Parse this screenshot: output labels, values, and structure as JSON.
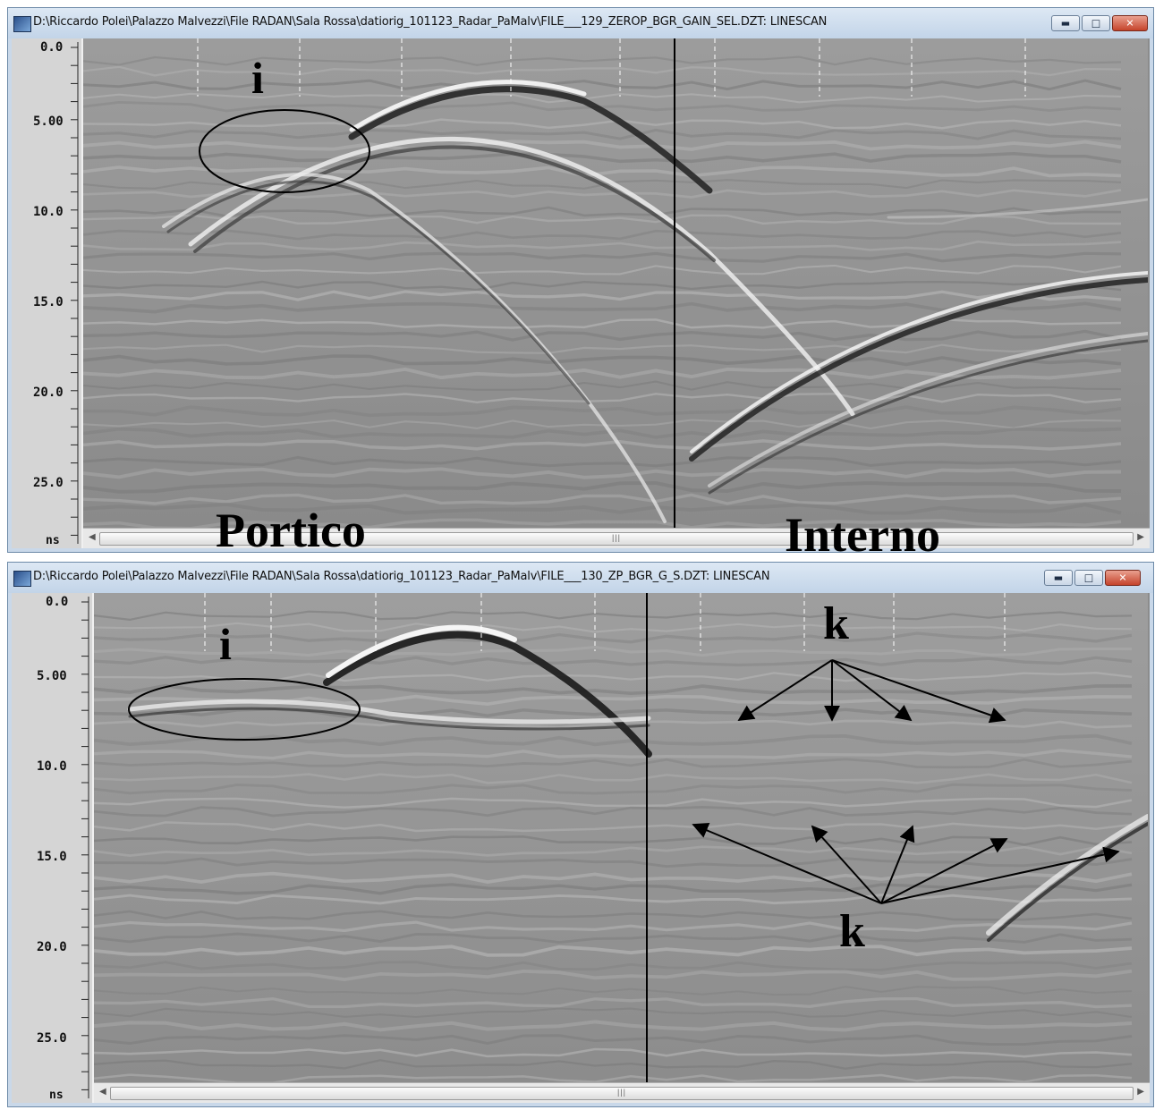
{
  "windows": [
    {
      "title": "D:\\Riccardo Polei\\Palazzo Malvezzi\\File RADAN\\Sala Rossa\\datiorig_101123_Radar_PaMalv\\FILE___129_ZEROP_BGR_GAIN_SEL.DZT:  LINESCAN",
      "axis_unit": "ns",
      "axis_labels": [
        "0.0",
        "5.00",
        "10.0",
        "15.0",
        "20.0",
        "25.0"
      ],
      "annotation_i": "i",
      "label_left": "Portico",
      "label_right": "Interno"
    },
    {
      "title": "D:\\Riccardo Polei\\Palazzo Malvezzi\\File RADAN\\Sala Rossa\\datiorig_101123_Radar_PaMalv\\FILE___130_ZP_BGR_G_S.DZT:  LINESCAN",
      "axis_unit": "ns",
      "axis_labels": [
        "0.0",
        "5.00",
        "10.0",
        "15.0",
        "20.0",
        "25.0"
      ],
      "annotation_i": "i",
      "annotation_k_top": "k",
      "annotation_k_bottom": "k"
    }
  ],
  "icons": {
    "minimize": "minimize-icon",
    "maximize": "maximize-icon",
    "close": "close-icon",
    "scroll_left": "arrow-left-icon",
    "scroll_right": "arrow-right-icon"
  },
  "scroll_grip": "|||"
}
